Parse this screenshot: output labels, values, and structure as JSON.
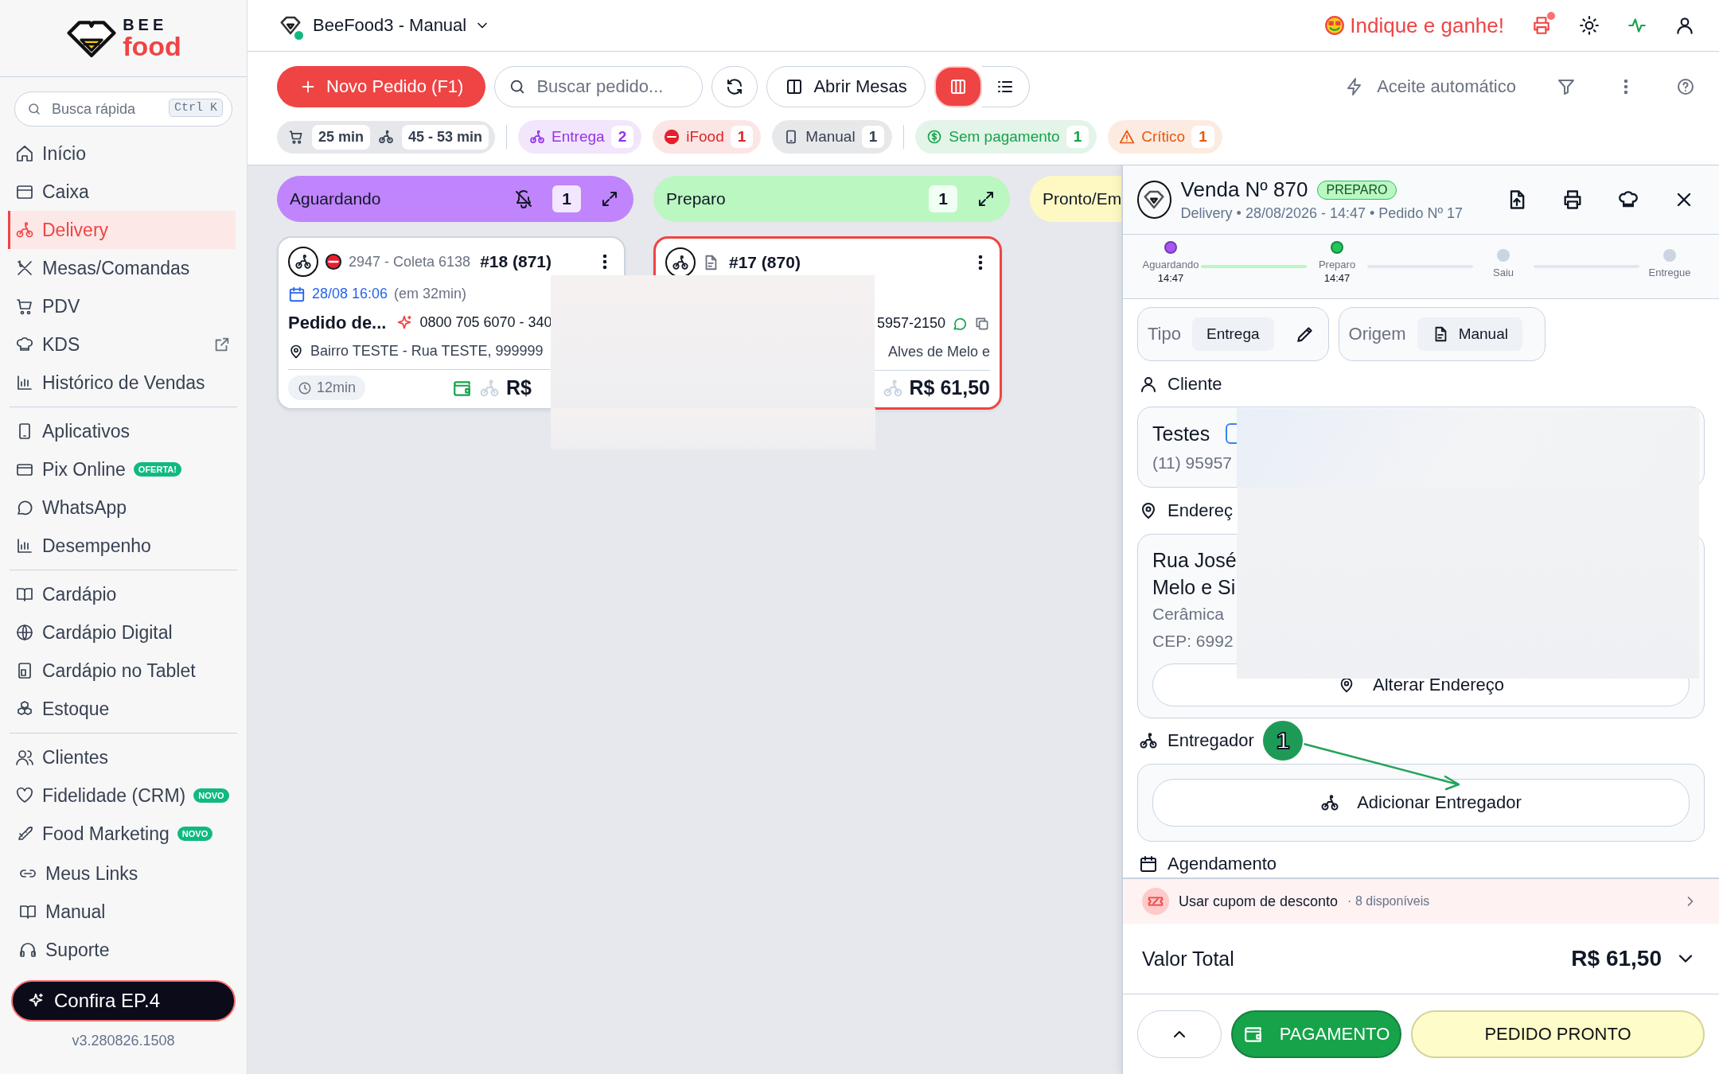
{
  "brand": {
    "name_top": "BEE",
    "name_bottom": "food"
  },
  "sidebar": {
    "search": {
      "placeholder": "Busca rápida",
      "shortcut": "Ctrl K"
    },
    "groups": [
      [
        {
          "label": "Início",
          "selected": false,
          "external": false
        },
        {
          "label": "Caixa",
          "selected": false,
          "external": false
        },
        {
          "label": "Delivery",
          "selected": true,
          "external": false
        },
        {
          "label": "Mesas/Comandas",
          "selected": false,
          "external": false
        },
        {
          "label": "PDV",
          "selected": false,
          "external": false
        },
        {
          "label": "KDS",
          "selected": false,
          "external": true
        },
        {
          "label": "Histórico de Vendas",
          "selected": false,
          "external": false
        }
      ],
      [
        {
          "label": "Aplicativos",
          "selected": false,
          "external": false
        },
        {
          "label": "Pix Online",
          "selected": false,
          "external": false,
          "badge": "OFERTA!"
        },
        {
          "label": "WhatsApp",
          "selected": false,
          "external": false
        },
        {
          "label": "Desempenho",
          "selected": false,
          "external": false
        }
      ],
      [
        {
          "label": "Cardápio",
          "selected": false,
          "external": false
        },
        {
          "label": "Cardápio Digital",
          "selected": false,
          "external": false
        },
        {
          "label": "Cardápio no Tablet",
          "selected": false,
          "external": false
        },
        {
          "label": "Estoque",
          "selected": false,
          "external": false
        }
      ],
      [
        {
          "label": "Clientes",
          "selected": false,
          "external": false
        },
        {
          "label": "Fidelidade (CRM)",
          "selected": false,
          "external": false,
          "badge": "NOVO"
        },
        {
          "label": "Food Marketing",
          "selected": false,
          "external": false,
          "badge": "NOVO"
        }
      ]
    ],
    "footer_links": [
      "Meus Links",
      "Manual",
      "Suporte"
    ],
    "promo_button": "Confira EP.4",
    "version": "v3.280826.1508"
  },
  "header": {
    "store": "BeeFood3 - Manual",
    "online": true,
    "referral": "Indique e ganhe!",
    "printer_alert": true
  },
  "toolbar": {
    "new_order": "Novo Pedido (F1)",
    "search_placeholder": "Buscar pedido...",
    "open_tables": "Abrir Mesas",
    "views": [
      {
        "selected": true
      },
      {
        "selected": false
      }
    ],
    "auto_accept": "Aceite automático"
  },
  "times": [
    "25 min",
    "45 - 53 min"
  ],
  "filters": [
    {
      "label": "Entrega",
      "count": "2",
      "color": "#9333ea"
    },
    {
      "label": "iFood",
      "count": "1",
      "color": "#dc2626"
    },
    {
      "label": "Manual",
      "count": "1",
      "color": "#374151"
    },
    {
      "label": "Sem pagamento",
      "count": "1",
      "color": "#16a34a"
    },
    {
      "label": "Crítico",
      "count": "1",
      "color": "#ea580c"
    }
  ],
  "columns": [
    {
      "title": "Aguardando",
      "count": "1",
      "color": "#c084fc",
      "muted": true,
      "cards": [
        {
          "kind": "ifood",
          "ref": "2947 - Coleta 6138",
          "number": "#18 (871)",
          "schedule": "28/08 16:06",
          "schedule_note": "(em 32min)",
          "customer": "Pedido de...",
          "phone": "0800 705 6070 - 340",
          "address": "Bairro TESTE - Rua TESTE, 999999",
          "elapsed": "12min",
          "total": "R$",
          "critical": false
        }
      ]
    },
    {
      "title": "Preparo",
      "count": "1",
      "color": "#bbf7c0",
      "muted": false,
      "cards": [
        {
          "kind": "manual",
          "number": "#17 (870)",
          "phone": "5957-2150",
          "address": "Alves de Melo e",
          "total": "R$ 61,50",
          "critical": true
        }
      ]
    },
    {
      "title": "Pronto/Em",
      "color": "#fef9c3"
    }
  ],
  "order": {
    "title": "Venda Nº 870",
    "status": "PREPARO",
    "subtitle": "Delivery • 28/08/2026 - 14:47 • Pedido Nº 17",
    "steps": [
      {
        "label": "Aguardando",
        "time": "14:47",
        "done": true,
        "color": "#a855f7"
      },
      {
        "label": "Preparo",
        "time": "14:47",
        "done": true,
        "color": "#22c55e"
      },
      {
        "label": "Saiu",
        "done": false,
        "color": "#cbd5e1"
      },
      {
        "label": "Entregue",
        "done": false,
        "color": "#cbd5e1"
      }
    ],
    "type": {
      "label": "Tipo",
      "value": "Entrega"
    },
    "origin": {
      "label": "Origem",
      "value": "Manual"
    },
    "client_label": "Cliente",
    "client_name": "Testes",
    "client_phone": "(11) 95957",
    "address_label": "Endereç",
    "address_lines": [
      "Rua José",
      "Melo e Si",
      "Cerâmica",
      "CEP: 6992"
    ],
    "change_address": "Alterar Endereço",
    "courier_label": "Entregador",
    "add_courier": "Adicionar Entregador",
    "schedule_label": "Agendamento",
    "coupon": "Usar cupom de desconto",
    "coupon_note": "· 8 disponíveis",
    "total_label": "Valor Total",
    "total": "R$ 61,50",
    "payment": "PAGAMENTO",
    "ready": "PEDIDO PRONTO"
  },
  "annotation": {
    "number": "1"
  }
}
